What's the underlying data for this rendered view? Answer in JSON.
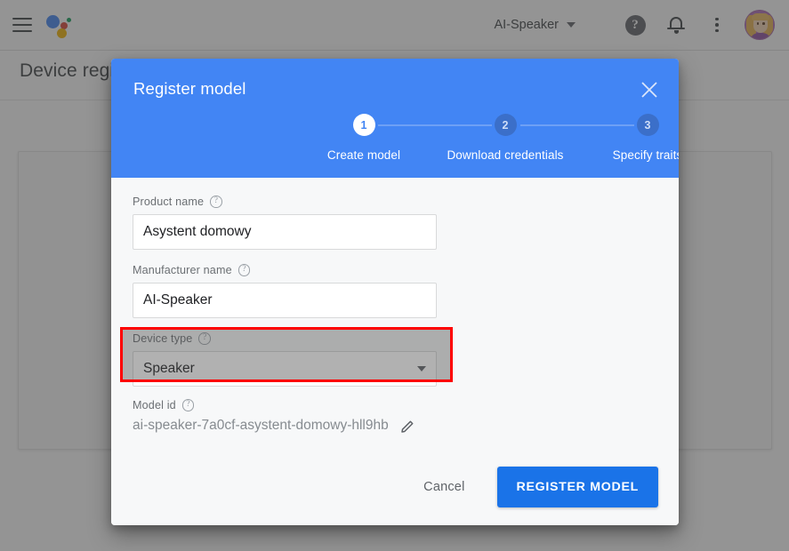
{
  "topbar": {
    "menu_icon": "hamburger-menu-icon",
    "logo_icon": "google-assistant-logo",
    "project_name": "AI-Speaker",
    "project_caret_icon": "chevron-down-icon",
    "help_icon": "help-icon",
    "help_glyph": "?",
    "notifications_icon": "bell-icon",
    "more_icon": "kebab-menu-icon",
    "avatar_icon": "user-avatar"
  },
  "page": {
    "title": "Device registry"
  },
  "dialog": {
    "title": "Register model",
    "close_icon": "close-icon",
    "stepper": [
      {
        "number": "1",
        "label": "Create model",
        "active": true
      },
      {
        "number": "2",
        "label": "Download credentials",
        "active": false
      },
      {
        "number": "3",
        "label": "Specify traits",
        "active": false
      }
    ],
    "fields": {
      "product_name": {
        "label": "Product name",
        "help_icon": "help-circle-icon",
        "value": "Asystent domowy",
        "placeholder": ""
      },
      "manufacturer_name": {
        "label": "Manufacturer name",
        "help_icon": "help-circle-icon",
        "value": "AI-Speaker",
        "placeholder": ""
      },
      "device_type": {
        "label": "Device type",
        "help_icon": "help-circle-icon",
        "value": "Speaker",
        "caret_icon": "chevron-down-icon",
        "highlighted": true
      },
      "model_id": {
        "label": "Model id",
        "help_icon": "help-circle-icon",
        "value": "ai-speaker-7a0cf-asystent-domowy-hll9hb",
        "edit_icon": "pencil-edit-icon"
      }
    },
    "footer": {
      "cancel_label": "Cancel",
      "submit_label": "REGISTER MODEL"
    }
  },
  "colors": {
    "header_blue": "#4285F4",
    "primary_button": "#1a73e8",
    "highlight_red": "#ff0000",
    "step_inactive": "#3b6fc9"
  }
}
